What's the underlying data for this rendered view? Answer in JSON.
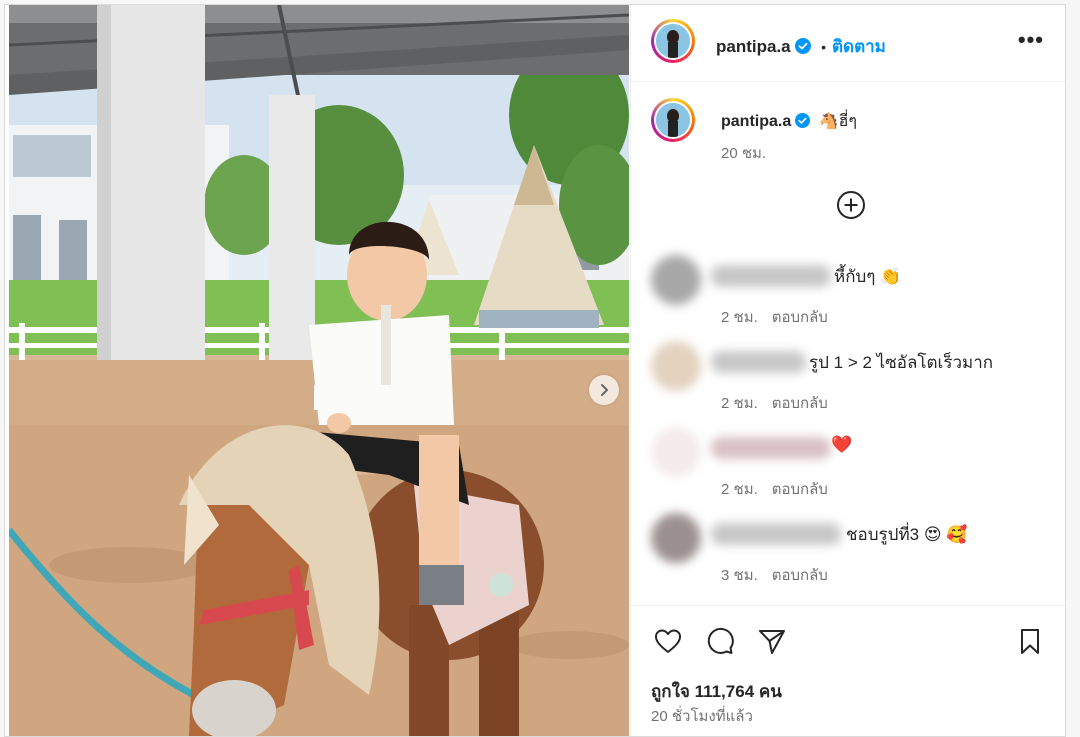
{
  "post": {
    "username": "pantipa.a",
    "follow_label": "ติดตาม",
    "separator": "•",
    "more_label": "•••",
    "caption": "ฮี่ๆ",
    "caption_emoji": "🐴",
    "caption_time": "20 ชม.",
    "likes": "ถูกใจ 111,764 คน",
    "posted_ago": "20 ชั่วโมงที่แล้ว"
  },
  "comments": [
    {
      "text": "หี้กับๆ 👏",
      "time": "2 ชม.",
      "reply": "ตอบกลับ"
    },
    {
      "text": "รูป 1 > 2 ไซอัลโตเร็วมาก",
      "time": "2 ชม.",
      "reply": "ตอบกลับ"
    },
    {
      "text": "❤️",
      "time": "2 ชม.",
      "reply": "ตอบกลับ"
    },
    {
      "text": "ชอบรูปที่3 😍 🥰",
      "time": "3 ชม.",
      "reply": "ตอบกลับ"
    }
  ],
  "colors": {
    "link_blue": "#0095f6",
    "verified_blue": "#0095f6",
    "muted_text": "#737373",
    "divider": "#efefef"
  },
  "icons": [
    "verified-badge-icon",
    "add-circle-icon",
    "heart-icon",
    "comment-icon",
    "share-icon",
    "save-icon",
    "chevron-right-icon",
    "more-icon"
  ]
}
